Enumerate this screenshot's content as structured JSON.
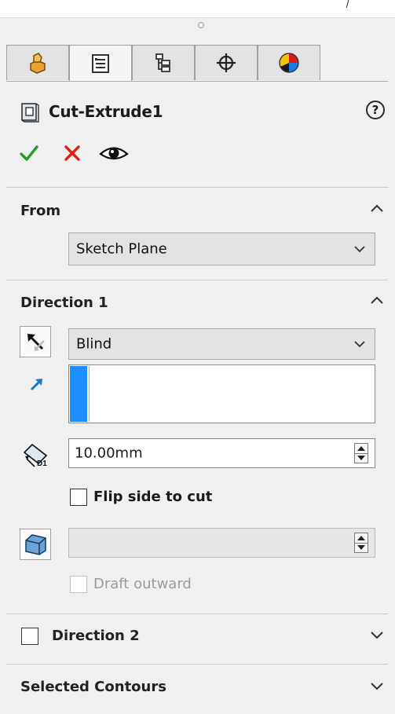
{
  "feature": {
    "title": "Cut-Extrude1",
    "help_label": "?"
  },
  "tabs": [
    {
      "name": "FeatureManager design tree",
      "icon": "part-icon"
    },
    {
      "name": "PropertyManager",
      "icon": "property-manager-icon",
      "active": true
    },
    {
      "name": "ConfigurationManager",
      "icon": "configuration-manager-icon"
    },
    {
      "name": "DimXpertManager",
      "icon": "crosshair-icon"
    },
    {
      "name": "DisplayManager",
      "icon": "appearance-icon"
    }
  ],
  "actions": {
    "ok": "ok-check-icon",
    "cancel": "cancel-x-icon",
    "preview": "preview-eye-icon"
  },
  "from": {
    "header": "From",
    "selected": "Sketch Plane"
  },
  "direction1": {
    "header": "Direction 1",
    "end_condition": "Blind",
    "depth_value": "10.00mm",
    "flip_side_label": "Flip side to cut",
    "flip_side_checked": false,
    "draft_value": "",
    "draft_outward_label": "Draft outward",
    "draft_outward_checked": false
  },
  "direction2": {
    "header": "Direction 2",
    "checked": false
  },
  "selected_contours": {
    "header": "Selected Contours"
  },
  "colors": {
    "ok_green": "#1fa02c",
    "cancel_red": "#e02018",
    "selection_blue": "#1e8fff"
  }
}
